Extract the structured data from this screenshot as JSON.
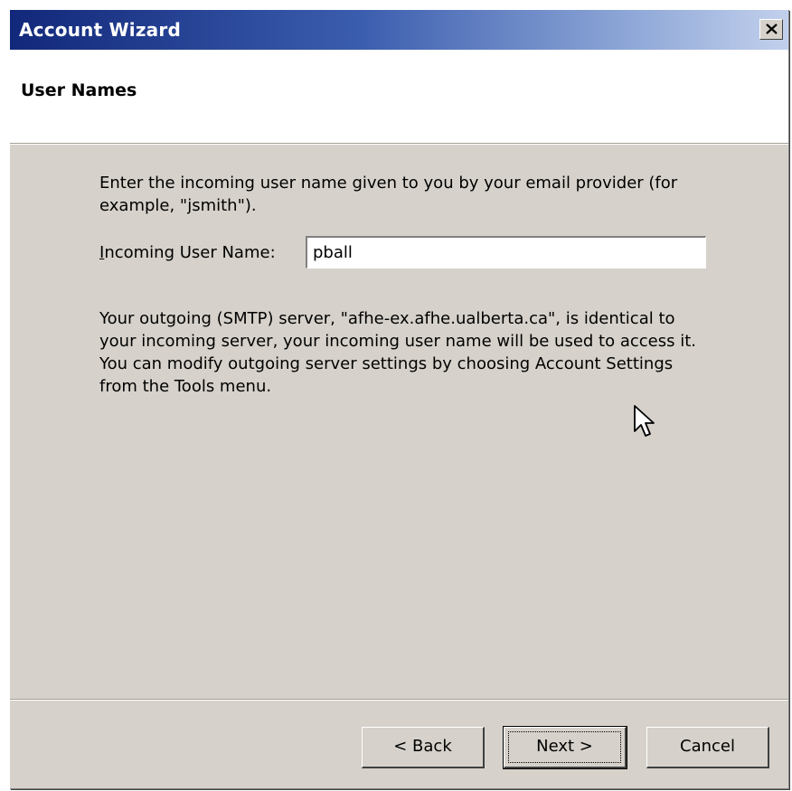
{
  "window": {
    "title": "Account Wizard"
  },
  "header": {
    "page_title": "User Names"
  },
  "content": {
    "instructions": "Enter the incoming user name given to you by your email provider (for example, \"jsmith\").",
    "incoming_label": "Incoming User Name:",
    "incoming_label_accesskey": "I",
    "incoming_label_rest": "ncoming User Name:",
    "incoming_value": "pball",
    "smtp_info": "Your outgoing (SMTP) server, \"afhe-ex.afhe.ualberta.ca\", is identical to your incoming server, your incoming user name will be used to access it. You can modify outgoing server settings by choosing Account Settings from the Tools menu."
  },
  "buttons": {
    "back": "< Back",
    "next": "Next >",
    "cancel": "Cancel"
  },
  "icons": {
    "close": "close-icon",
    "cursor": "mouse-pointer-icon"
  },
  "colors": {
    "titlebar_start": "#12287a",
    "titlebar_end": "#c2d0ec",
    "dialog_face": "#d6d2cb"
  }
}
